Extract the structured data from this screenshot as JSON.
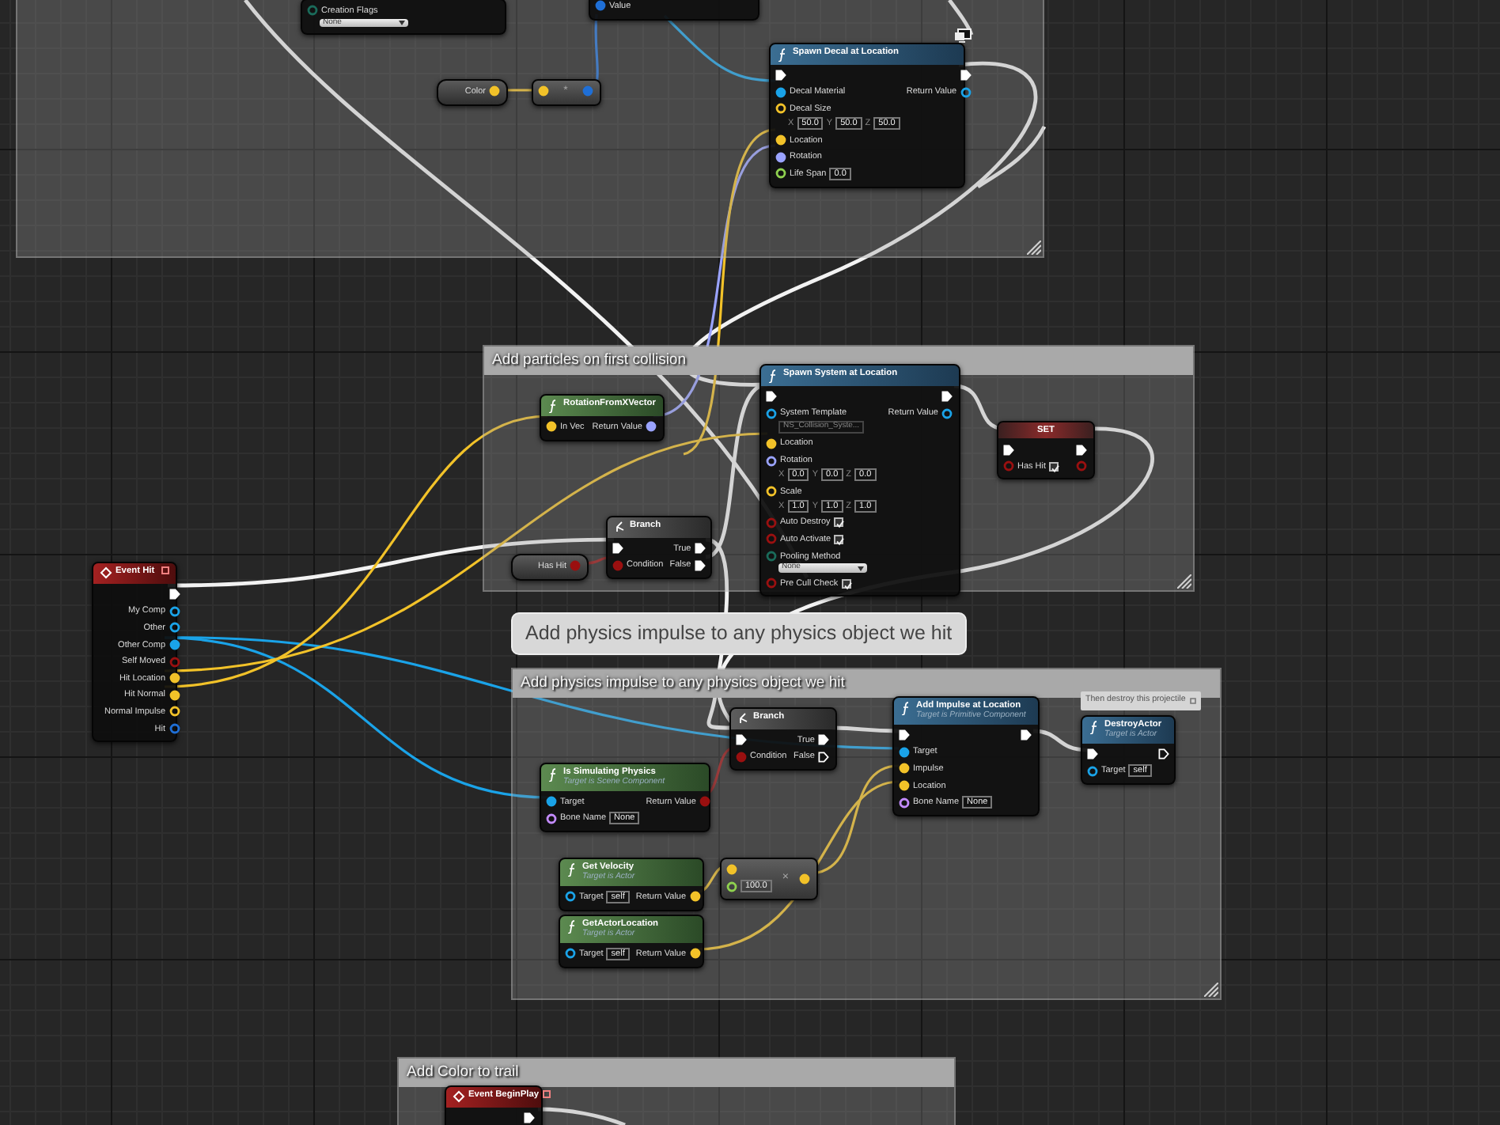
{
  "comments": [
    {
      "resize_handle": true
    },
    {
      "title": "Add particles on first collision",
      "resize_handle": true
    },
    {
      "title": "Add physics impulse to any physics object we hit",
      "bubble": "Add physics impulse to any physics object we hit",
      "resize_handle": true
    },
    {
      "title": "Add Color to trail",
      "resize_handle": false
    }
  ],
  "notes": [
    {
      "text": "Then destroy this projectile"
    }
  ],
  "nodes": [
    {
      "kind": "partial",
      "inputs": [
        {
          "kind": "data",
          "color": "#1a6b5a",
          "label": "Creation Flags",
          "connected": false,
          "dropdown": "None"
        }
      ]
    },
    {
      "kind": "partial",
      "inputs": [
        {
          "kind": "data",
          "color": "#1f6fd6",
          "label": "Value",
          "connected": true
        }
      ]
    },
    {
      "kind": "getter",
      "outputs": [
        {
          "kind": "data",
          "color": "#f2c229",
          "label": "Color",
          "connected": true
        }
      ]
    },
    {
      "kind": "operator",
      "symbol": "*",
      "inputs": [
        {
          "kind": "data",
          "color": "#f2c229",
          "connected": true
        }
      ],
      "outputs": [
        {
          "kind": "data",
          "color": "#1f6fd6",
          "connected": true
        }
      ]
    },
    {
      "kind": "function",
      "title": "Spawn Decal at Location",
      "network_icon": true,
      "inputs": [
        {
          "kind": "exec",
          "connected": true
        },
        {
          "kind": "data",
          "color": "#1aa3e8",
          "label": "Decal Material",
          "connected": true
        },
        {
          "kind": "data",
          "color": "#f2c229",
          "label": "Decal Size",
          "connected": false,
          "vector": [
            {
              "axis": "X",
              "value": "50.0"
            },
            {
              "axis": "Y",
              "value": "50.0"
            },
            {
              "axis": "Z",
              "value": "50.0"
            }
          ]
        },
        {
          "kind": "data",
          "color": "#f2c229",
          "label": "Location",
          "connected": true
        },
        {
          "kind": "data",
          "color": "#9aa3ff",
          "label": "Rotation",
          "connected": true
        },
        {
          "kind": "data",
          "color": "#8fd14f",
          "label": "Life Span",
          "connected": false,
          "value": "0.0"
        }
      ],
      "outputs": [
        {
          "kind": "exec",
          "connected": true
        },
        {
          "kind": "data",
          "color": "#1aa3e8",
          "label": "Return Value",
          "connected": false
        }
      ]
    },
    {
      "kind": "pure",
      "title": "RotationFromXVector",
      "inputs": [
        {
          "kind": "data",
          "color": "#f2c229",
          "label": "In Vec",
          "connected": true
        }
      ],
      "outputs": [
        {
          "kind": "data",
          "color": "#9aa3ff",
          "label": "Return Value",
          "connected": true
        }
      ]
    },
    {
      "kind": "function",
      "title": "Spawn System at Location",
      "inputs": [
        {
          "kind": "exec",
          "connected": true
        },
        {
          "kind": "data",
          "color": "#1aa3e8",
          "label": "System Template",
          "connected": false,
          "asset": "NS_Collision_Syste..."
        },
        {
          "kind": "data",
          "color": "#f2c229",
          "label": "Location",
          "connected": true
        },
        {
          "kind": "data",
          "color": "#9aa3ff",
          "label": "Rotation",
          "connected": false,
          "vector": [
            {
              "axis": "X",
              "value": "0.0"
            },
            {
              "axis": "Y",
              "value": "0.0"
            },
            {
              "axis": "Z",
              "value": "0.0"
            }
          ]
        },
        {
          "kind": "data",
          "color": "#f2c229",
          "label": "Scale",
          "connected": false,
          "vector": [
            {
              "axis": "X",
              "value": "1.0"
            },
            {
              "axis": "Y",
              "value": "1.0"
            },
            {
              "axis": "Z",
              "value": "1.0"
            }
          ]
        },
        {
          "kind": "data",
          "color": "#9a1010",
          "label": "Auto Destroy",
          "connected": false,
          "checked": true
        },
        {
          "kind": "data",
          "color": "#9a1010",
          "label": "Auto Activate",
          "connected": false,
          "checked": true
        },
        {
          "kind": "data",
          "color": "#1a6b5a",
          "label": "Pooling Method",
          "connected": false,
          "dropdown": "None"
        },
        {
          "kind": "data",
          "color": "#9a1010",
          "label": "Pre Cull Check",
          "connected": false,
          "checked": true
        }
      ],
      "outputs": [
        {
          "kind": "exec",
          "connected": true
        },
        {
          "kind": "data",
          "color": "#1aa3e8",
          "label": "Return Value",
          "connected": false
        }
      ]
    },
    {
      "kind": "set",
      "title": "SET",
      "inputs": [
        {
          "kind": "exec",
          "connected": true
        },
        {
          "kind": "data",
          "color": "#9a1010",
          "label": "Has Hit",
          "connected": false,
          "checked": true
        }
      ],
      "outputs": [
        {
          "kind": "exec",
          "connected": true
        },
        {
          "kind": "data",
          "color": "#9a1010",
          "connected": false
        }
      ]
    },
    {
      "kind": "getter",
      "outputs": [
        {
          "kind": "data",
          "color": "#9a1010",
          "label": "Has Hit",
          "connected": true
        }
      ]
    },
    {
      "kind": "macro",
      "title": "Branch",
      "inputs": [
        {
          "kind": "exec",
          "connected": true
        },
        {
          "kind": "data",
          "color": "#9a1010",
          "label": "Condition",
          "connected": true
        }
      ],
      "outputs": [
        {
          "kind": "exec",
          "label": "True",
          "connected": true
        },
        {
          "kind": "exec",
          "label": "False",
          "connected": true
        }
      ]
    },
    {
      "kind": "event",
      "title": "Event Hit",
      "outputs": [
        {
          "kind": "exec",
          "connected": true
        },
        {
          "kind": "data",
          "color": "#1aa3e8",
          "label": "My Comp",
          "connected": false
        },
        {
          "kind": "data",
          "color": "#1aa3e8",
          "label": "Other",
          "connected": false
        },
        {
          "kind": "data",
          "color": "#1aa3e8",
          "label": "Other Comp",
          "connected": true
        },
        {
          "kind": "data",
          "color": "#9a1010",
          "label": "Self Moved",
          "connected": false
        },
        {
          "kind": "data",
          "color": "#f2c229",
          "label": "Hit Location",
          "connected": true
        },
        {
          "kind": "data",
          "color": "#f2c229",
          "label": "Hit Normal",
          "connected": true
        },
        {
          "kind": "data",
          "color": "#f2c229",
          "label": "Normal Impulse",
          "connected": false
        },
        {
          "kind": "data",
          "color": "#1f6fd6",
          "label": "Hit",
          "connected": false
        }
      ]
    },
    {
      "kind": "macro",
      "title": "Branch",
      "inputs": [
        {
          "kind": "exec",
          "connected": true
        },
        {
          "kind": "data",
          "color": "#9a1010",
          "label": "Condition",
          "connected": true
        }
      ],
      "outputs": [
        {
          "kind": "exec",
          "label": "True",
          "connected": true
        },
        {
          "kind": "exec",
          "label": "False",
          "connected": false
        }
      ]
    },
    {
      "kind": "function",
      "title": "Add Impulse at Location",
      "subtitle": "Target is Primitive Component",
      "inputs": [
        {
          "kind": "exec",
          "connected": true
        },
        {
          "kind": "data",
          "color": "#1aa3e8",
          "label": "Target",
          "connected": true
        },
        {
          "kind": "data",
          "color": "#f2c229",
          "label": "Impulse",
          "connected": true
        },
        {
          "kind": "data",
          "color": "#f2c229",
          "label": "Location",
          "connected": true
        },
        {
          "kind": "data",
          "color": "#c38bff",
          "label": "Bone Name",
          "connected": false,
          "value": "None"
        }
      ],
      "outputs": [
        {
          "kind": "exec",
          "connected": true
        }
      ]
    },
    {
      "kind": "function",
      "title": "DestroyActor",
      "subtitle": "Target is Actor",
      "inputs": [
        {
          "kind": "exec",
          "connected": true
        },
        {
          "kind": "data",
          "color": "#1aa3e8",
          "label": "Target",
          "connected": false,
          "value": "self"
        }
      ],
      "outputs": [
        {
          "kind": "exec",
          "connected": false
        }
      ]
    },
    {
      "kind": "pure",
      "title": "Is Simulating Physics",
      "subtitle": "Target is Scene Component",
      "inputs": [
        {
          "kind": "data",
          "color": "#1aa3e8",
          "label": "Target",
          "connected": true
        },
        {
          "kind": "data",
          "color": "#c38bff",
          "label": "Bone Name",
          "connected": false,
          "value": "None"
        }
      ],
      "outputs": [
        {
          "kind": "data",
          "color": "#9a1010",
          "label": "Return Value",
          "connected": true
        }
      ]
    },
    {
      "kind": "pure",
      "title": "Get Velocity",
      "subtitle": "Target is Actor",
      "inputs": [
        {
          "kind": "data",
          "color": "#1aa3e8",
          "label": "Target",
          "connected": false,
          "value": "self"
        }
      ],
      "outputs": [
        {
          "kind": "data",
          "color": "#f2c229",
          "label": "Return Value",
          "connected": true
        }
      ]
    },
    {
      "kind": "operator",
      "symbol": "×",
      "inputs": [
        {
          "kind": "data",
          "color": "#f2c229",
          "connected": true
        },
        {
          "kind": "data",
          "color": "#8fd14f",
          "connected": false,
          "value": "100.0"
        }
      ],
      "outputs": [
        {
          "kind": "data",
          "color": "#f2c229",
          "connected": true
        }
      ]
    },
    {
      "kind": "pure",
      "title": "GetActorLocation",
      "subtitle": "Target is Actor",
      "inputs": [
        {
          "kind": "data",
          "color": "#1aa3e8",
          "label": "Target",
          "connected": false,
          "value": "self"
        }
      ],
      "outputs": [
        {
          "kind": "data",
          "color": "#f2c229",
          "label": "Return Value",
          "connected": true
        }
      ]
    },
    {
      "kind": "event",
      "title": "Event BeginPlay",
      "outputs": [
        {
          "kind": "exec",
          "connected": true
        }
      ]
    }
  ]
}
